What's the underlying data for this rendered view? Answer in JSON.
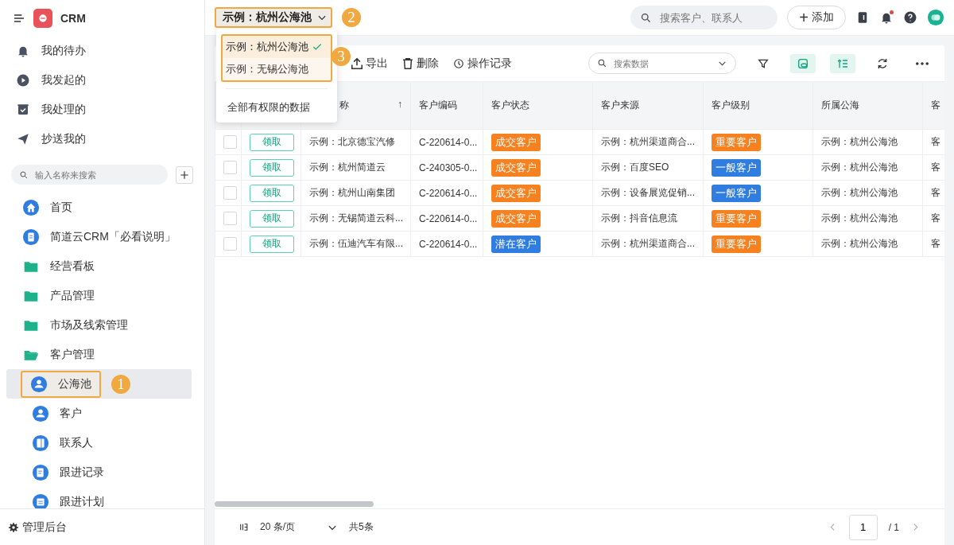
{
  "app": {
    "name": "CRM"
  },
  "sidebar": {
    "quick_items": [
      {
        "kind": "todo",
        "label": "我的待办"
      },
      {
        "kind": "initiated",
        "label": "我发起的"
      },
      {
        "kind": "handled",
        "label": "我处理的"
      },
      {
        "kind": "cc",
        "label": "抄送我的"
      }
    ],
    "search": {
      "placeholder": "输入名称来搜索"
    },
    "nav": [
      {
        "kind": "home",
        "label": "首页",
        "selected": false
      },
      {
        "kind": "doc",
        "label": "简道云CRM「必看说明」",
        "selected": false
      },
      {
        "kind": "folder",
        "label": "经营看板",
        "expanded": false,
        "selected": false
      },
      {
        "kind": "folder",
        "label": "产品管理",
        "expanded": false,
        "selected": false
      },
      {
        "kind": "folder",
        "label": "市场及线索管理",
        "expanded": false,
        "selected": false
      },
      {
        "kind": "folder",
        "label": "客户管理",
        "expanded": true,
        "selected": false,
        "children": [
          {
            "kind": "pool",
            "label": "公海池",
            "selected": true,
            "callout": "1"
          },
          {
            "kind": "person",
            "label": "客户",
            "selected": false
          },
          {
            "kind": "contact",
            "label": "联系人",
            "selected": false
          },
          {
            "kind": "record",
            "label": "跟进记录",
            "selected": false
          },
          {
            "kind": "plan",
            "label": "跟进计划",
            "selected": false
          }
        ]
      }
    ],
    "footer": "管理后台"
  },
  "header": {
    "pool_selector": {
      "value": "示例：杭州公海池",
      "callout": "2"
    },
    "search": {
      "placeholder": "搜索客户、联系人"
    },
    "add_button": {
      "icon": "+",
      "label": "添加"
    },
    "notifications": {
      "unread": true
    }
  },
  "pool_menu": {
    "callout": "3",
    "options": [
      {
        "label": "示例：杭州公海池",
        "selected": true
      },
      {
        "label": "示例：无锡公海池",
        "selected": false
      }
    ],
    "all_option": "全部有权限的数据"
  },
  "toolbar": {
    "buttons": [
      {
        "kind": "export",
        "label": "导出"
      },
      {
        "kind": "delete",
        "label": "删除"
      },
      {
        "kind": "log",
        "label": "操作记录"
      }
    ],
    "search": {
      "placeholder": "搜索数据"
    },
    "view_toggles": [
      {
        "kind": "view",
        "on": true
      },
      {
        "kind": "sort",
        "on": true
      }
    ]
  },
  "table": {
    "columns": [
      {
        "label": "称",
        "sort": "↑"
      },
      {
        "label": "客户编码"
      },
      {
        "label": "客户状态"
      },
      {
        "label": "客户来源"
      },
      {
        "label": "客户级别"
      },
      {
        "label": "所属公海"
      },
      {
        "label": "客"
      }
    ],
    "rows": [
      {
        "checked": false,
        "action": "领取",
        "name": "示例：北京德宝汽修",
        "code": "C-220614-0...",
        "status": {
          "text": "成交客户",
          "color": "#f7801f"
        },
        "source": "示例：杭州渠道商合...",
        "level": {
          "text": "重要客户",
          "color": "#f7801f"
        },
        "pool": "示例：杭州公海池",
        "column_9": "客"
      },
      {
        "checked": false,
        "action": "领取",
        "name": "示例：杭州简道云",
        "code": "C-240305-0...",
        "status": {
          "text": "成交客户",
          "color": "#f7801f"
        },
        "source": "示例：百度SEO",
        "level": {
          "text": "一般客户",
          "color": "#2f7de1"
        },
        "pool": "示例：杭州公海池",
        "column_9": "客"
      },
      {
        "checked": false,
        "action": "领取",
        "name": "示例：杭州山南集团",
        "code": "C-220614-0...",
        "status": {
          "text": "成交客户",
          "color": "#f7801f"
        },
        "source": "示例：设备展览促销...",
        "level": {
          "text": "一般客户",
          "color": "#2f7de1"
        },
        "pool": "示例：杭州公海池",
        "column_9": "客"
      },
      {
        "checked": false,
        "action": "领取",
        "name": "示例：无锡简道云科...",
        "code": "C-220614-0...",
        "status": {
          "text": "成交客户",
          "color": "#f7801f"
        },
        "source": "示例：抖音信息流",
        "level": {
          "text": "重要客户",
          "color": "#f7801f"
        },
        "pool": "示例：杭州公海池",
        "column_9": "客"
      },
      {
        "checked": false,
        "action": "领取",
        "name": "示例：伍迪汽车有限...",
        "code": "C-220614-0...",
        "status": {
          "text": "潜在客户",
          "color": "#2f7de1"
        },
        "source": "示例：杭州渠道商合...",
        "level": {
          "text": "重要客户",
          "color": "#f7801f"
        },
        "pool": "示例：杭州公海池",
        "column_9": "客"
      }
    ]
  },
  "pagination": {
    "page_size": "20 条/页",
    "total": "共5条",
    "page": "1",
    "pages": "/ 1"
  }
}
